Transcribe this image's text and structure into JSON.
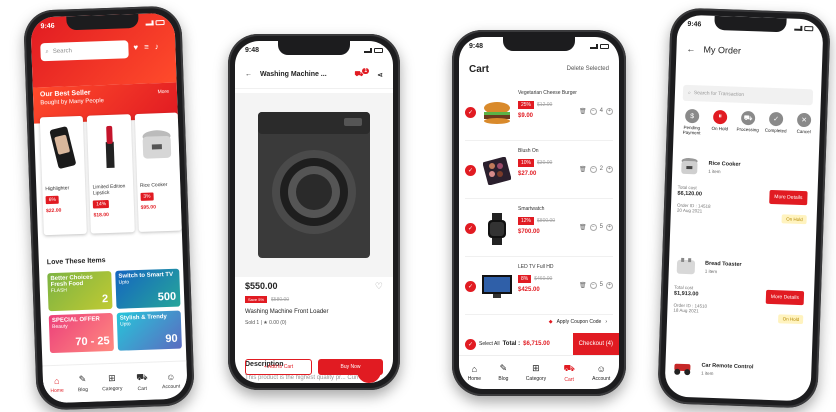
{
  "colors": {
    "accent": "#e11b22"
  },
  "phone1": {
    "time": "9:46",
    "search_placeholder": "Search",
    "best_seller_title": "Our Best Seller",
    "best_seller_subtitle": "Bought by Many People",
    "more": "More",
    "products": [
      {
        "name": "Highlighter",
        "badge": "6%",
        "price": "$22.00"
      },
      {
        "name": "Limited Edition Lipstick",
        "badge": "14%",
        "price": "$18.00"
      },
      {
        "name": "Rice Cooker",
        "badge": "3%",
        "price": "$95.00"
      }
    ],
    "love_title": "Love These Items",
    "banners": [
      {
        "title": "Better Choices Fresh Food",
        "big": "2",
        "sub": "FLASH"
      },
      {
        "title": "Switch to Smart TV",
        "big": "500",
        "sub": "Upto"
      },
      {
        "title": "SPECIAL OFFER",
        "big": "70 - 25",
        "sub": "Beauty"
      },
      {
        "title": "Stylish & Trendy",
        "big": "90",
        "sub": "Upto"
      }
    ],
    "nav": [
      "Home",
      "Blog",
      "Category",
      "Cart",
      "Account"
    ]
  },
  "phone2": {
    "time": "9:48",
    "title": "Washing Machine ...",
    "cart_count": "1",
    "price": "$550.00",
    "save_badge": "Save 5%",
    "old_price": "$580.00",
    "product_name": "Washing Machine Front Loader",
    "meta": "Sold 1 | ★ 0.00 (0)",
    "description_title": "Description",
    "description_text": "This product is the highest quality pr... Currently only available for demo pu...",
    "add_to_cart": "+ Add to Cart",
    "buy_now": "Buy Now"
  },
  "phone3": {
    "time": "9:48",
    "title": "Cart",
    "delete_selected": "Delete Selected",
    "items": [
      {
        "name": "Vegetarian Cheese Burger",
        "badge": "25%",
        "old": "$12.00",
        "price": "$9.00",
        "qty": "4"
      },
      {
        "name": "Blush On",
        "badge": "10%",
        "old": "$30.00",
        "price": "$27.00",
        "qty": "2"
      },
      {
        "name": "Smartwatch",
        "badge": "12%",
        "old": "$800.00",
        "price": "$700.00",
        "qty": "5"
      },
      {
        "name": "LED TV Full HD",
        "badge": "8%",
        "old": "$460.00",
        "price": "$425.00",
        "qty": "5"
      }
    ],
    "coupon": "Apply Coupon Code",
    "select_all": "Select All",
    "total_label": "Total :",
    "total_value": "$6,715.00",
    "checkout": "Checkout (4)",
    "nav": [
      "Home",
      "Blog",
      "Category",
      "Cart",
      "Account"
    ]
  },
  "phone4": {
    "time": "9:46",
    "title": "My Order",
    "search_placeholder": "Search for Transaction",
    "steps": [
      "Pending Payment",
      "On Hold",
      "Processing",
      "Completed",
      "Cancel"
    ],
    "orders": [
      {
        "name": "Rice Cooker",
        "items": "1 item",
        "total_label": "Total cost",
        "total": "$6,120.00",
        "order_id": "Order ID : 14518",
        "date": "20 Aug 2021",
        "button": "More Details",
        "status": "On Hold"
      },
      {
        "name": "Bread Toaster",
        "items": "1 item",
        "total_label": "Total cost",
        "total": "$1,913.00",
        "order_id": "Order ID : 14510",
        "date": "18 Aug 2021",
        "button": "More Details",
        "status": "On Hold"
      },
      {
        "name": "Car Remote Control",
        "items": "1 item"
      }
    ]
  }
}
